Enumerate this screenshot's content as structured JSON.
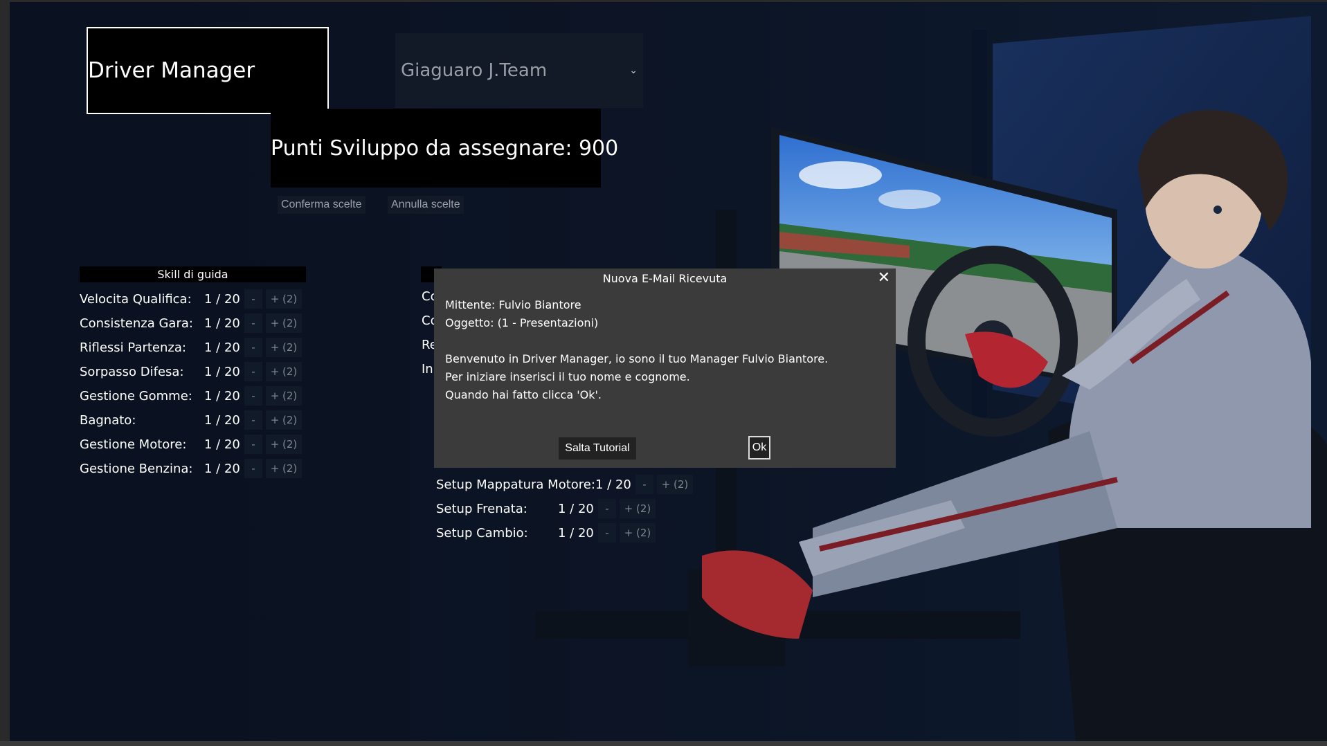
{
  "app": {
    "title": "Driver Manager"
  },
  "team_select": {
    "selected": "Giaguaro J.Team"
  },
  "points": {
    "text": "Punti Sviluppo da assegnare: 900"
  },
  "actions": {
    "confirm": "Conferma scelte",
    "cancel": "Annulla scelte"
  },
  "skills": {
    "header": "Skill di guida",
    "rows": [
      {
        "label": "Velocita Qualifica:",
        "value": "1 / 20",
        "minus": "-",
        "plus": "+ (2)"
      },
      {
        "label": "Consistenza Gara:",
        "value": "1 / 20",
        "minus": "-",
        "plus": "+ (2)"
      },
      {
        "label": "Riflessi Partenza:",
        "value": "1 / 20",
        "minus": "-",
        "plus": "+ (2)"
      },
      {
        "label": "Sorpasso Difesa:",
        "value": "1 / 20",
        "minus": "-",
        "plus": "+ (2)"
      },
      {
        "label": "Gestione Gomme:",
        "value": "1 / 20",
        "minus": "-",
        "plus": "+ (2)"
      },
      {
        "label": "Bagnato:",
        "value": "1 / 20",
        "minus": "-",
        "plus": "+ (2)"
      },
      {
        "label": "Gestione Motore:",
        "value": "1 / 20",
        "minus": "-",
        "plus": "+ (2)"
      },
      {
        "label": "Gestione Benzina:",
        "value": "1 / 20",
        "minus": "-",
        "plus": "+ (2)"
      }
    ]
  },
  "setup": {
    "partial_labels": [
      "Co",
      "Co",
      "Re",
      "In"
    ],
    "rows": [
      {
        "label": "Setup Mappatura Motore:",
        "value": "1 / 20",
        "minus": "-",
        "plus": "+ (2)"
      },
      {
        "label": "Setup Frenata:",
        "value": "1 / 20",
        "minus": "-",
        "plus": "+ (2)"
      },
      {
        "label": "Setup Cambio:",
        "value": "1 / 20",
        "minus": "-",
        "plus": "+ (2)"
      }
    ]
  },
  "modal": {
    "title": "Nuova E-Mail Ricevuta",
    "close": "✕",
    "sender": "Mittente: Fulvio Biantore",
    "subject": "Oggetto: (1 - Presentazioni)",
    "body": [
      "Benvenuto in Driver Manager, io sono il tuo Manager Fulvio Biantore.",
      "Per iniziare inserisci il tuo nome e cognome.",
      "Quando hai fatto clicca 'Ok'."
    ],
    "skip": "Salta Tutorial",
    "ok": "Ok"
  },
  "colors": {
    "background": "#0a1222",
    "modal": "#3b3b3b",
    "button_dark": "#121a28"
  }
}
